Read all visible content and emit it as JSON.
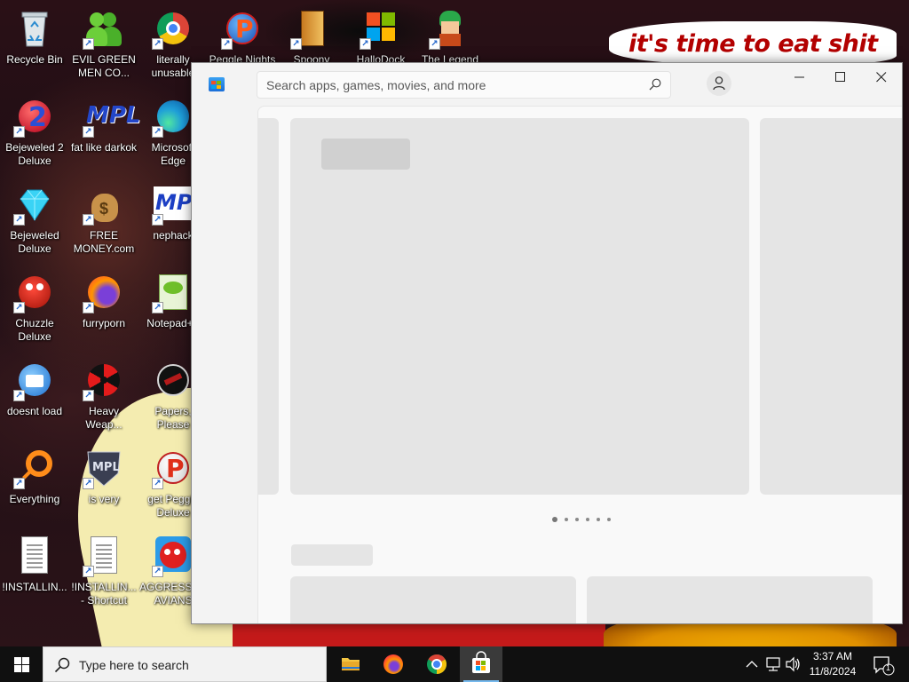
{
  "wallpaper": {
    "caption": "it's time to eat shit"
  },
  "desktop": {
    "icons": [
      {
        "label": "Recycle Bin",
        "icon": "recycle-bin-icon",
        "shortcut": false
      },
      {
        "label": "EVIL GREEN MEN CO...",
        "icon": "people-icon",
        "shortcut": true
      },
      {
        "label": "literally unusable",
        "icon": "chrome-icon",
        "shortcut": true
      },
      {
        "label": "Peggle Nights",
        "icon": "peggle-icon",
        "shortcut": true
      },
      {
        "label": "Spoony",
        "icon": "book-icon",
        "shortcut": true
      },
      {
        "label": "HalloDock",
        "icon": "windows-logo-icon",
        "shortcut": true
      },
      {
        "label": "The Legend",
        "icon": "character-icon",
        "shortcut": true
      },
      {
        "label": "Bejeweled 2 Deluxe",
        "icon": "bejeweled2-icon",
        "shortcut": true
      },
      {
        "label": "fat like darkok",
        "icon": "mpl-icon",
        "shortcut": true
      },
      {
        "label": "Microsoft Edge",
        "icon": "edge-icon",
        "shortcut": true
      },
      {
        "label": "Bejeweled Deluxe",
        "icon": "gem-icon",
        "shortcut": true
      },
      {
        "label": "FREE MONEY.com",
        "icon": "money-bag-icon",
        "shortcut": true
      },
      {
        "label": "nephack",
        "icon": "mpi-icon",
        "shortcut": true
      },
      {
        "label": "Chuzzle Deluxe",
        "icon": "chuzzle-icon",
        "shortcut": true
      },
      {
        "label": "furryporn",
        "icon": "firefox-icon",
        "shortcut": true
      },
      {
        "label": "Notepad++",
        "icon": "notepad-plus-icon",
        "shortcut": true
      },
      {
        "label": "doesnt load",
        "icon": "thunderbird-icon",
        "shortcut": true
      },
      {
        "label": "Heavy Weap...",
        "icon": "radiation-icon",
        "shortcut": true
      },
      {
        "label": "Papers, Please",
        "icon": "papers-please-icon",
        "shortcut": true
      },
      {
        "label": "Everything",
        "icon": "search-ring-icon",
        "shortcut": true
      },
      {
        "label": "is very",
        "icon": "shield-mpl-icon",
        "shortcut": true
      },
      {
        "label": "get Peggle Deluxe",
        "icon": "peggle-icon",
        "shortcut": true
      },
      {
        "label": "!INSTALLIN...",
        "icon": "text-file-icon",
        "shortcut": false
      },
      {
        "label": "!INSTALLIN... - Shortcut",
        "icon": "text-file-icon",
        "shortcut": true
      },
      {
        "label": "AGGRESSIVE AVIANS",
        "icon": "angry-bird-icon",
        "shortcut": true
      }
    ]
  },
  "store": {
    "search_placeholder": "Search apps, games, movies, and more",
    "icons": {
      "logo": "microsoft-store-icon",
      "search": "search-icon",
      "account": "user-icon",
      "minimize": "minimize-icon",
      "maximize": "maximize-icon",
      "close": "close-icon"
    },
    "carousel": {
      "page_count": 6,
      "active_page": 1
    }
  },
  "taskbar": {
    "search_placeholder": "Type here to search",
    "apps": [
      {
        "name": "file-explorer",
        "icon": "folder-icon",
        "active": false
      },
      {
        "name": "firefox",
        "icon": "firefox-icon",
        "active": false
      },
      {
        "name": "chrome",
        "icon": "chrome-icon",
        "active": false
      },
      {
        "name": "microsoft-store",
        "icon": "microsoft-store-icon",
        "active": true
      }
    ],
    "tray": {
      "time": "3:37 AM",
      "date": "11/8/2024",
      "notification_count": "1"
    }
  },
  "colors": {
    "accent": "#76b9ed",
    "taskbar": "#101010",
    "window_bg": "#f3f3f3",
    "skeleton": "#e5e5e5"
  }
}
